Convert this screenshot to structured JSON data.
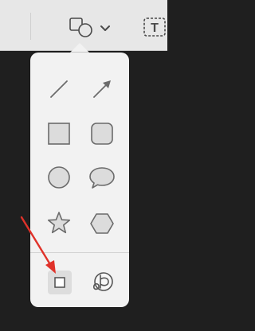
{
  "toolbar": {
    "shapes_button": {
      "icon": "shapes-icon",
      "chevron": "chevron-down-icon"
    },
    "text_button": {
      "icon": "text-box-icon",
      "label": "T"
    }
  },
  "popover": {
    "shapes": [
      {
        "name": "line",
        "icon": "line-icon"
      },
      {
        "name": "arrow",
        "icon": "arrow-icon"
      },
      {
        "name": "rectangle",
        "icon": "rectangle-icon"
      },
      {
        "name": "rounded-rectangle",
        "icon": "rounded-rectangle-icon"
      },
      {
        "name": "oval",
        "icon": "oval-icon"
      },
      {
        "name": "speech-bubble",
        "icon": "speech-bubble-icon"
      },
      {
        "name": "star",
        "icon": "star-icon"
      },
      {
        "name": "polygon",
        "icon": "hexagon-icon"
      }
    ],
    "tools": [
      {
        "name": "mask",
        "icon": "mask-rectangle-icon",
        "selected": true
      },
      {
        "name": "loupe",
        "icon": "loupe-icon",
        "selected": false
      }
    ]
  },
  "annotation": {
    "color": "#e0322a",
    "icon": "red-arrow-annotation"
  },
  "colors": {
    "shape_fill": "#dcdcdc",
    "shape_stroke": "#6b6b6b",
    "popover_bg": "#f2f2f2",
    "toolbar_bg": "#e7e7e7",
    "background": "#1f1f1f"
  }
}
